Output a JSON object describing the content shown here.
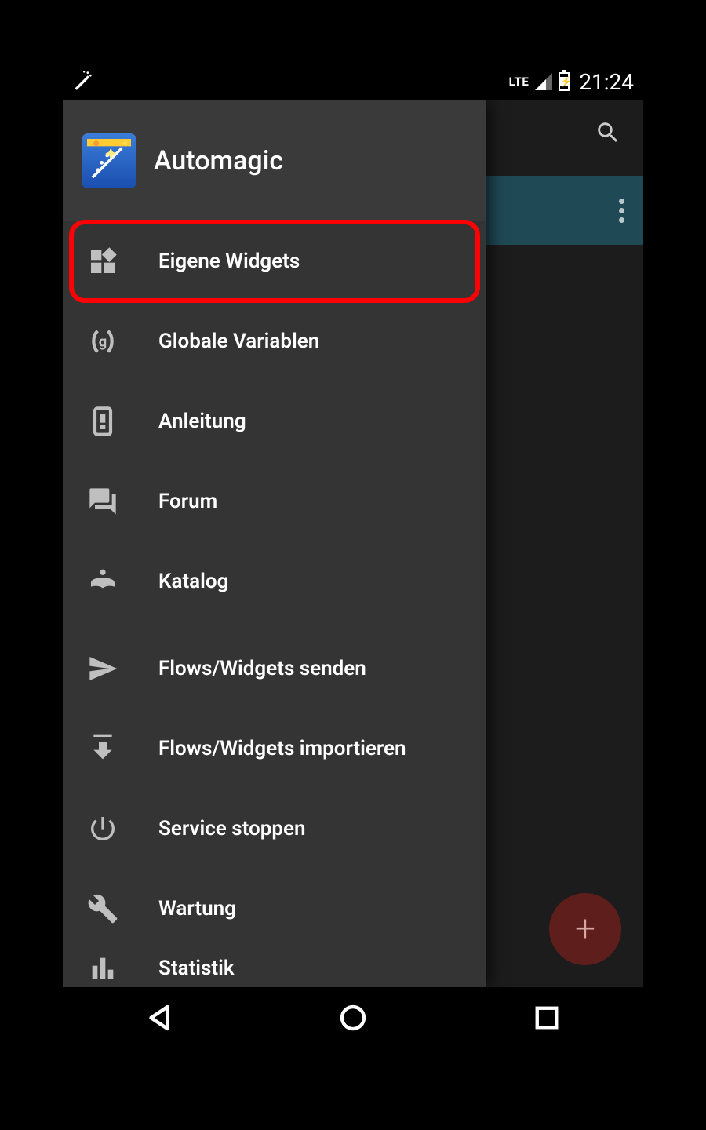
{
  "status": {
    "network_type": "LTE",
    "clock": "21:24"
  },
  "drawer": {
    "app_name": "Automagic",
    "section1": [
      {
        "id": "own-widgets",
        "label": "Eigene Widgets",
        "highlight": true
      },
      {
        "id": "global-vars",
        "label": "Globale Variablen"
      },
      {
        "id": "manual",
        "label": "Anleitung"
      },
      {
        "id": "forum",
        "label": "Forum"
      },
      {
        "id": "catalog",
        "label": "Katalog"
      }
    ],
    "section2": [
      {
        "id": "send",
        "label": "Flows/Widgets senden"
      },
      {
        "id": "import",
        "label": "Flows/Widgets importieren"
      },
      {
        "id": "stop-service",
        "label": "Service stoppen"
      },
      {
        "id": "maintenance",
        "label": "Wartung"
      },
      {
        "id": "stats",
        "label": "Statistik"
      }
    ]
  },
  "fab": {
    "label": "+"
  }
}
